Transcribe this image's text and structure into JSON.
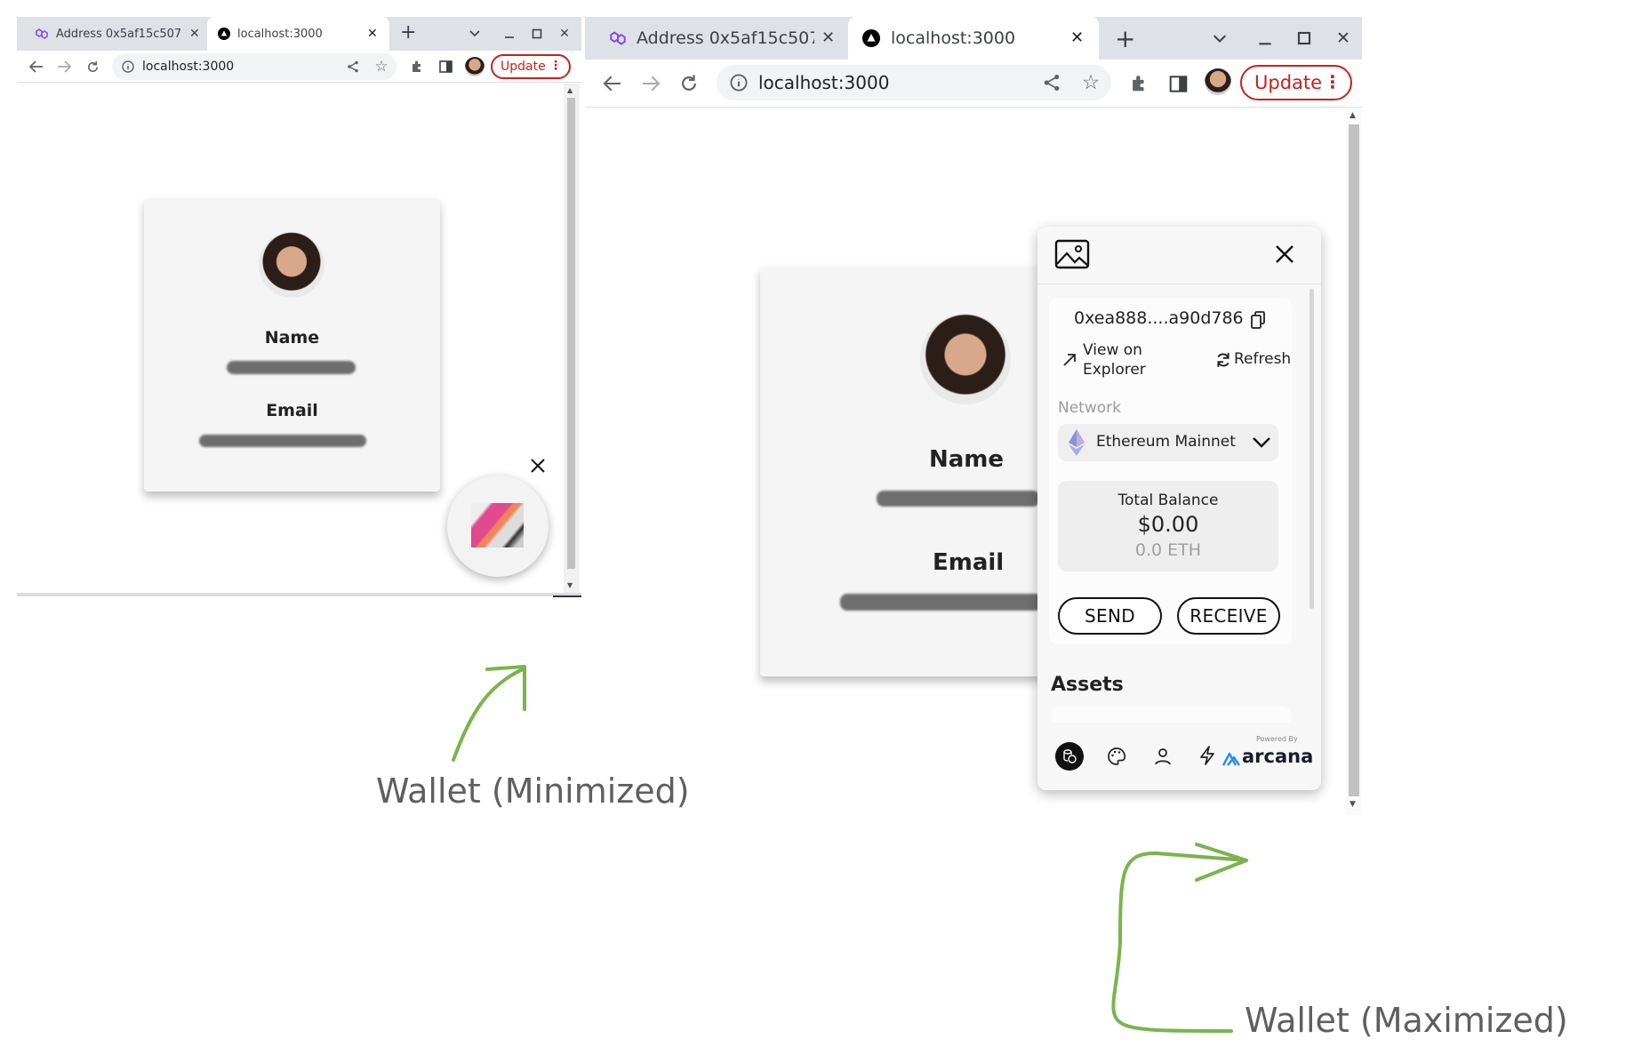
{
  "left_window": {
    "tabs": [
      {
        "title": "Address 0x5af15c507",
        "icon": "polygon-icon"
      },
      {
        "title": "localhost:3000",
        "icon": "next-triangle-icon"
      }
    ],
    "new_tab_symbol": "+",
    "address": "localhost:3000",
    "update_label": "Update",
    "card": {
      "name_label": "Name",
      "email_label": "Email"
    }
  },
  "right_window": {
    "tabs": [
      {
        "title": "Address 0x5af15c507",
        "icon": "polygon-icon"
      },
      {
        "title": "localhost:3000",
        "icon": "next-triangle-icon"
      }
    ],
    "new_tab_symbol": "+",
    "address": "localhost:3000",
    "update_label": "Update",
    "card": {
      "name_label": "Name",
      "email_label": "Email"
    },
    "wallet": {
      "address": "0xea888....a90d786",
      "view_on_explorer": "View on Explorer",
      "refresh": "Refresh",
      "network_label": "Network",
      "network": "Ethereum Mainnet",
      "total_balance_label": "Total Balance",
      "total_balance": "$0.00",
      "eth_balance": "0.0 ETH",
      "send_label": "SEND",
      "receive_label": "RECEIVE",
      "assets_label": "Assets",
      "powered_by": "Powered By",
      "brand": "arcana"
    }
  },
  "annotations": {
    "minimized": "Wallet (Minimized)",
    "maximized": "Wallet (Maximized)"
  },
  "colors": {
    "annotation_arrow": "#7bb34d",
    "update_red": "#c5221f",
    "arcana_blue": "#2a8cf0",
    "eth_purple": "#8a92d6"
  }
}
